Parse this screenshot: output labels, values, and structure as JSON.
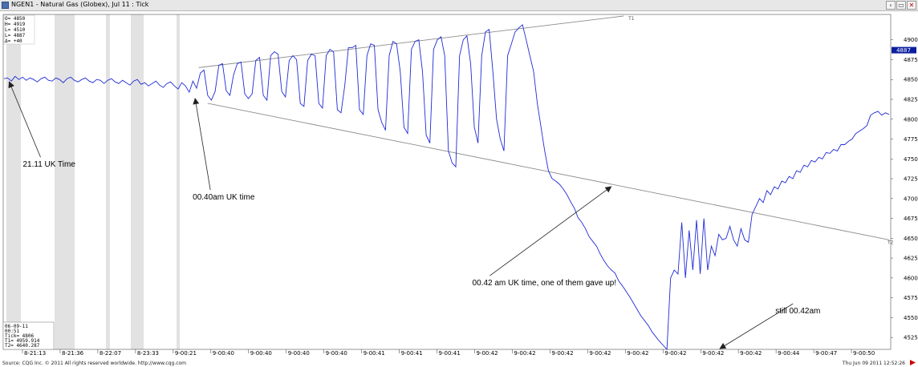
{
  "window": {
    "title": "NGEN1 - Natural Gas (Globex), Jul 11 : Tick",
    "buttons": [
      "‹",
      "▭",
      "✕"
    ]
  },
  "colors": {
    "price_line": "#1f2bd6",
    "trendline": "#8c8c8c",
    "session_band": "#e2e2e2",
    "price_tag": "#0b1f9e",
    "grid": "#c8c8c8"
  },
  "info_top": [
    "O=   4850",
    "H=   4919",
    "L=   4510",
    "L=   4887",
    "Δ=     +40"
  ],
  "info_bottom": [
    "06-09-11",
    "00:51",
    "Tick=      4806",
    "T1=   4959.914",
    "T2=   4640.287"
  ],
  "footer": {
    "source": "Source: CQG Inc. © 2011 All rights reserved worldwide. http://www.cqg.com",
    "timestamp": "Thu Jun 09 2011 12:52:26"
  },
  "chart_data": {
    "type": "line",
    "ylim": [
      4510,
      4930
    ],
    "yticks": [
      4525,
      4550,
      4575,
      4600,
      4625,
      4650,
      4675,
      4700,
      4725,
      4750,
      4775,
      4800,
      4825,
      4850,
      4875,
      4900
    ],
    "current_price": "4887",
    "x_tick_labels": [
      "8-21:13",
      "8-21:36",
      "8-22:07",
      "8-23:33",
      "9-00:21",
      "9-00:40",
      "9-00:40",
      "9-00:40",
      "9-00:40",
      "9-00:41",
      "9-00:41",
      "9-00:41",
      "9-00:42",
      "9-00:42",
      "9-00:42",
      "9-00:42",
      "9-00:42",
      "9-00:42",
      "9-00:42",
      "9-00:42",
      "9-00:44",
      "9-00:47",
      "9-00:50"
    ],
    "series": [
      {
        "values": [
          4851,
          4852,
          4848,
          4854,
          4850,
          4853,
          4849,
          4852,
          4850,
          4847,
          4851,
          4853,
          4849,
          4848,
          4852,
          4850,
          4846,
          4851,
          4853,
          4849,
          4847,
          4850,
          4852,
          4848,
          4846,
          4850,
          4849,
          4845,
          4849,
          4851,
          4847,
          4845,
          4849,
          4846,
          4843,
          4848,
          4850,
          4844,
          4846,
          4842,
          4845,
          4848,
          4843,
          4840,
          4845,
          4847,
          4842,
          4838,
          4846,
          4842,
          4834,
          4848,
          4839,
          4858,
          4862,
          4830,
          4824,
          4835,
          4868,
          4870,
          4836,
          4830,
          4856,
          4870,
          4872,
          4832,
          4826,
          4832,
          4874,
          4878,
          4830,
          4824,
          4880,
          4885,
          4882,
          4835,
          4828,
          4874,
          4880,
          4875,
          4820,
          4816,
          4874,
          4882,
          4880,
          4820,
          4814,
          4880,
          4888,
          4885,
          4812,
          4808,
          4842,
          4890,
          4890,
          4893,
          4812,
          4806,
          4880,
          4895,
          4893,
          4812,
          4796,
          4786,
          4880,
          4898,
          4895,
          4860,
          4790,
          4782,
          4888,
          4898,
          4900,
          4860,
          4780,
          4770,
          4888,
          4900,
          4904,
          4880,
          4760,
          4745,
          4740,
          4880,
          4900,
          4905,
          4870,
          4790,
          4770,
          4880,
          4910,
          4913,
          4860,
          4800,
          4775,
          4760,
          4880,
          4895,
          4910,
          4915,
          4919,
          4900,
          4880,
          4860,
          4820,
          4790,
          4760,
          4735,
          4725,
          4722,
          4718,
          4712,
          4705,
          4696,
          4688,
          4676,
          4670,
          4662,
          4652,
          4646,
          4640,
          4630,
          4622,
          4615,
          4610,
          4606,
          4596,
          4590,
          4583,
          4576,
          4568,
          4560,
          4552,
          4546,
          4540,
          4532,
          4526,
          4520,
          4515,
          4510,
          4600,
          4610,
          4605,
          4670,
          4600,
          4660,
          4610,
          4673,
          4605,
          4675,
          4610,
          4640,
          4628,
          4655,
          4648,
          4650,
          4665,
          4648,
          4640,
          4662,
          4648,
          4645,
          4680,
          4690,
          4700,
          4695,
          4710,
          4705,
          4715,
          4712,
          4722,
          4720,
          4728,
          4725,
          4735,
          4733,
          4742,
          4740,
          4748,
          4746,
          4752,
          4750,
          4758,
          4757,
          4762,
          4760,
          4768,
          4768,
          4772,
          4775,
          4782,
          4785,
          4788,
          4792,
          4805,
          4808,
          4810,
          4805,
          4808,
          4806
        ]
      }
    ],
    "trendlines": [
      {
        "name": "T1",
        "x": [
          0.22,
          0.7
        ],
        "y": [
          4865,
          4930
        ]
      },
      {
        "name": "T2",
        "x": [
          0.23,
          1.0
        ],
        "y": [
          4820,
          4648
        ]
      }
    ],
    "annotations": [
      {
        "text": "21.11 UK Time",
        "at": 0.005,
        "price": 4848
      },
      {
        "text": "00.40am UK time",
        "at": 0.215,
        "price": 4827
      },
      {
        "text": "00.42 am UK time, one of them gave up!",
        "at": 0.685,
        "price": 4716
      },
      {
        "text": "still 00.42am",
        "at": 0.808,
        "price": 4512
      }
    ]
  }
}
